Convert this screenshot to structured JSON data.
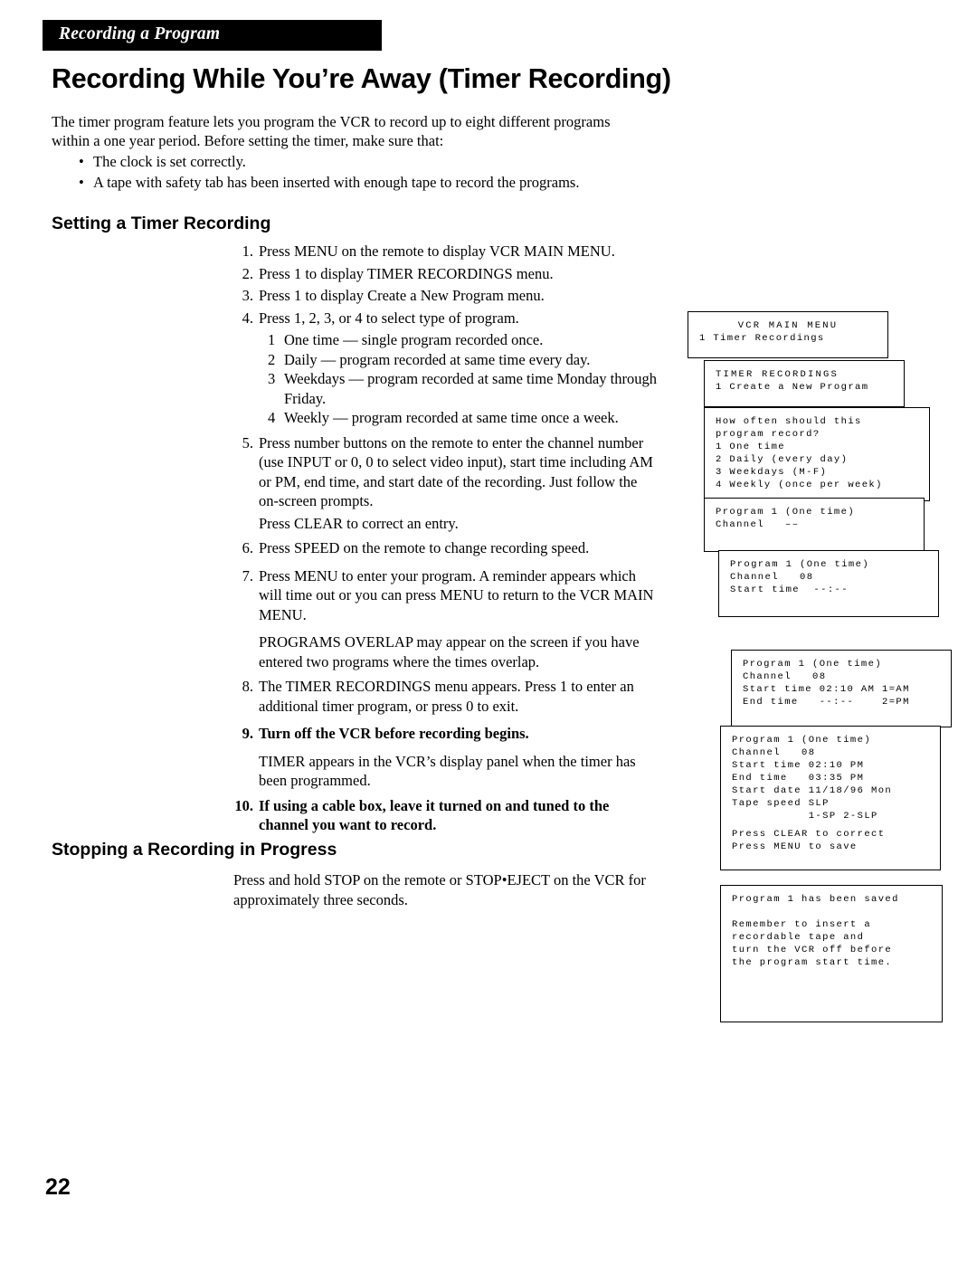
{
  "header": {
    "running_head": "Recording a Program"
  },
  "title": "Recording While You’re Away (Timer Recording)",
  "intro": {
    "paragraph": "The timer program feature lets you program the VCR to record up to eight different programs within a one year period.  Before setting the timer, make sure that:",
    "bullets": [
      "The clock is set correctly.",
      "A tape with safety tab has been inserted with enough tape to record the programs."
    ]
  },
  "sections": {
    "setting_heading": "Setting a Timer Recording",
    "stopping_heading": "Stopping a Recording in Progress",
    "stopping_body": "Press and hold STOP on the remote or STOP•EJECT on the VCR for approximately three seconds."
  },
  "steps": [
    {
      "num": "1.",
      "text": "Press MENU on the remote to display VCR MAIN MENU."
    },
    {
      "num": "2.",
      "text": "Press 1 to display TIMER RECORDINGS menu."
    },
    {
      "num": "3.",
      "text": "Press 1 to display Create a New Program menu."
    },
    {
      "num": "4.",
      "text": "Press 1, 2, 3, or 4 to select type of program."
    },
    {
      "num": "5.",
      "text": "Press number buttons on the remote to enter the channel number (use INPUT or 0, 0 to select video input), start time including AM or PM, end time, and start date of the recording.  Just follow the on-screen prompts."
    },
    {
      "num": "5b",
      "text": "Press CLEAR to correct an entry."
    },
    {
      "num": "6.",
      "text": "Press SPEED on the remote to change recording speed."
    },
    {
      "num": "7.",
      "text": "Press MENU to enter your program.  A reminder appears which will time out or you can press MENU to return to the VCR MAIN MENU."
    },
    {
      "num": "7b",
      "text": "PROGRAMS OVERLAP may appear on the screen if you have entered two programs where the times overlap."
    },
    {
      "num": "8.",
      "text": "The TIMER RECORDINGS menu appears.  Press 1 to enter an additional timer program, or press 0 to exit."
    },
    {
      "num": "9.",
      "text": "Turn off the VCR before recording begins."
    },
    {
      "num": "9b",
      "text": "TIMER appears in the VCR’s display panel when the timer has been programmed."
    },
    {
      "num": "10.",
      "text": "If using a cable box, leave it turned on and tuned to the channel you want to record."
    }
  ],
  "substeps": [
    {
      "num": "1",
      "text": "One time — single program recorded once."
    },
    {
      "num": "2",
      "text": "Daily — program recorded at same time every day."
    },
    {
      "num": "3",
      "text": "Weekdays — program recorded at same time Monday through Friday."
    },
    {
      "num": "4",
      "text": "Weekly — program recorded at same time once a week."
    }
  ],
  "screens": [
    {
      "id": "vcr-main-menu",
      "lines": [
        "VCR MAIN MENU",
        "1 Timer Recordings"
      ]
    },
    {
      "id": "timer-recordings",
      "lines": [
        "TIMER RECORDINGS",
        "1 Create a New Program"
      ]
    },
    {
      "id": "how-often",
      "lines": [
        "How often should this",
        "program record?",
        "1 One time",
        "2 Daily (every day)",
        "3 Weekdays (M-F)",
        "4 Weekly (once per week)"
      ]
    },
    {
      "id": "program-channel-prompt",
      "lines": [
        "Program 1 (One time)",
        "Channel   ––"
      ]
    },
    {
      "id": "program-start-time-prompt",
      "lines": [
        "Program 1 (One time)",
        "Channel   08",
        "Start time  --:--"
      ]
    },
    {
      "id": "program-end-time-prompt",
      "lines": [
        "Program 1 (One time)",
        "Channel   08",
        "Start time 02:10 AM 1=AM",
        "End time   --:--    2=PM"
      ]
    },
    {
      "id": "program-complete",
      "lines": [
        "Program 1 (One time)",
        "Channel   08",
        "Start time 02:10 PM",
        "End time   03:35 PM",
        "Start date 11/18/96 Mon",
        "Tape speed SLP",
        "           1-SP 2-SLP",
        "Press CLEAR to correct",
        "Press MENU to save"
      ]
    },
    {
      "id": "program-saved",
      "lines": [
        "Program 1 has been saved",
        "",
        "Remember to insert a",
        "recordable tape and",
        "turn the VCR off before",
        "the program start time."
      ]
    }
  ],
  "page_number": "22"
}
